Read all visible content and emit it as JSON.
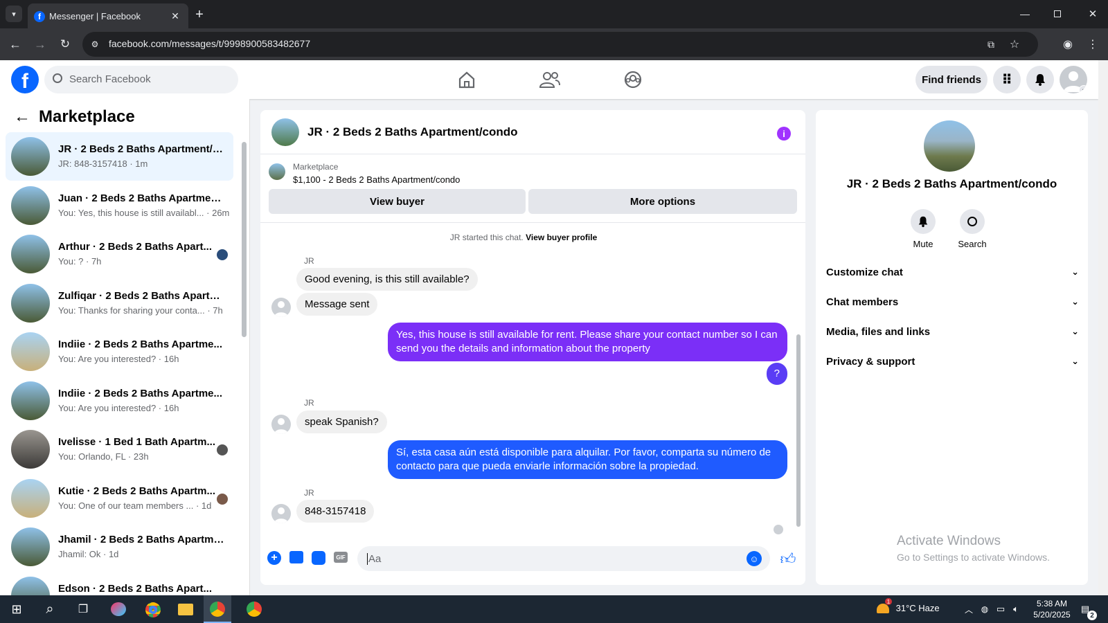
{
  "browser": {
    "tab_title": "Messenger | Facebook",
    "url": "facebook.com/messages/t/9998900583482677"
  },
  "header": {
    "search_placeholder": "Search Facebook",
    "find_friends": "Find friends"
  },
  "sidebar": {
    "title": "Marketplace",
    "conversations": [
      {
        "title": "JR · 2 Beds 2 Baths Apartment/c...",
        "preview": "JR: 848-3157418 · 1m",
        "active": true
      },
      {
        "title": "Juan · 2 Beds 2 Baths Apartment...",
        "preview": "You: Yes, this house is still availabl... · 26m"
      },
      {
        "title": "Arthur · 2 Beds 2 Baths Apart...",
        "preview": "You: ? · 7h"
      },
      {
        "title": "Zulfiqar · 2 Beds 2 Baths Apartm...",
        "preview": "You: Thanks for sharing your conta... · 7h"
      },
      {
        "title": "Indiie · 2 Beds 2 Baths Apartme...",
        "preview": "You: Are you interested? · 16h"
      },
      {
        "title": "Indiie · 2 Beds 2 Baths Apartme...",
        "preview": "You: Are you interested? · 16h"
      },
      {
        "title": "Ivelisse · 1 Bed 1 Bath Apartm...",
        "preview": "You: Orlando, FL · 23h"
      },
      {
        "title": "Kutie · 2 Beds 2 Baths Apartm...",
        "preview": "You: One of our team members ... · 1d"
      },
      {
        "title": "Jhamil · 2 Beds 2 Baths Apartme...",
        "preview": "Jhamil: Ok · 1d"
      },
      {
        "title": "Edson · 2 Beds 2 Baths Apart...",
        "preview": ""
      }
    ]
  },
  "chat": {
    "title": "JR · 2 Beds 2 Baths Apartment/condo",
    "listing_label": "Marketplace",
    "listing_price": "$1,100 - 2 Beds 2 Baths Apartment/condo",
    "view_buyer": "View buyer",
    "more_options": "More options",
    "started_text": "JR started this chat.",
    "view_buyer_profile": "View buyer profile",
    "sender_name": "JR",
    "messages": {
      "m1": "Good evening, is this still available?",
      "m2": "Message sent",
      "m3": "Yes, this house is still available for rent. Please share your contact number so I can send you the details and information about the property",
      "m4": "?",
      "m5": "speak Spanish?",
      "m6": "Sí, esta casa aún está disponible para alquilar. Por favor, comparta su número de contacto para que pueda enviarle información sobre la propiedad.",
      "m7": "848-3157418"
    },
    "composer_placeholder": "Aa"
  },
  "info": {
    "title": "JR · 2 Beds 2 Baths Apartment/condo",
    "mute": "Mute",
    "search": "Search",
    "sections": [
      "Customize chat",
      "Chat members",
      "Media, files and links",
      "Privacy & support"
    ],
    "watermark_title": "Activate Windows",
    "watermark_sub": "Go to Settings to activate Windows."
  },
  "taskbar": {
    "weather": "31°C  Haze",
    "weather_badge": "1",
    "time": "5:38 AM",
    "date": "5/20/2025",
    "notif_count": "2"
  },
  "colors": {
    "accent": "#0866ff",
    "bubble_purple": "#7b2ff7",
    "bubble_blue": "#1f5bff"
  }
}
